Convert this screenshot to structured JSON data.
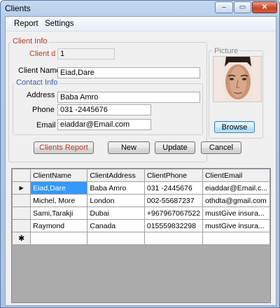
{
  "window": {
    "title": "Clients"
  },
  "menu": [
    "Report",
    "Settings"
  ],
  "client_info": {
    "group_label": "Client Info",
    "id_label": "Client d",
    "id_value": "1",
    "name_label": "Client Name",
    "name_value": "Eiad,Dare"
  },
  "contact_info": {
    "group_label": "Contact Info",
    "address_label": "Address",
    "address_value": "Baba Amro",
    "phone_label": "Phone",
    "phone_value": "031 -2445676",
    "email_label": "Email",
    "email_value": "eiaddar@Email.com"
  },
  "picture": {
    "group_label": "Picture",
    "browse_label": "Browse"
  },
  "buttons": {
    "report": "Clients Report",
    "new": "New",
    "update": "Update",
    "cancel": "Cancel"
  },
  "grid": {
    "columns": [
      "ClientName",
      "ClientAddress",
      "ClientPhone",
      "ClientEmail"
    ],
    "rows": [
      [
        "Eiad,Dare",
        "Baba Amro",
        "031 -2445676",
        "eiaddar@Email.c..."
      ],
      [
        "Michel, More",
        "London",
        "002-55687237",
        "othdta@gmail.com"
      ],
      [
        "Sami,Tarakji",
        "Dubai",
        "+967967067522",
        "mustGive insura..."
      ],
      [
        "Raymond",
        "Canada",
        "015559832298",
        "mustGive insura..."
      ]
    ],
    "current_row_marker": "▶",
    "new_row_marker": "✱"
  },
  "colors": {
    "selection": "#3399ff",
    "label_red": "#b43c28",
    "label_blue": "#3c5fa8"
  }
}
